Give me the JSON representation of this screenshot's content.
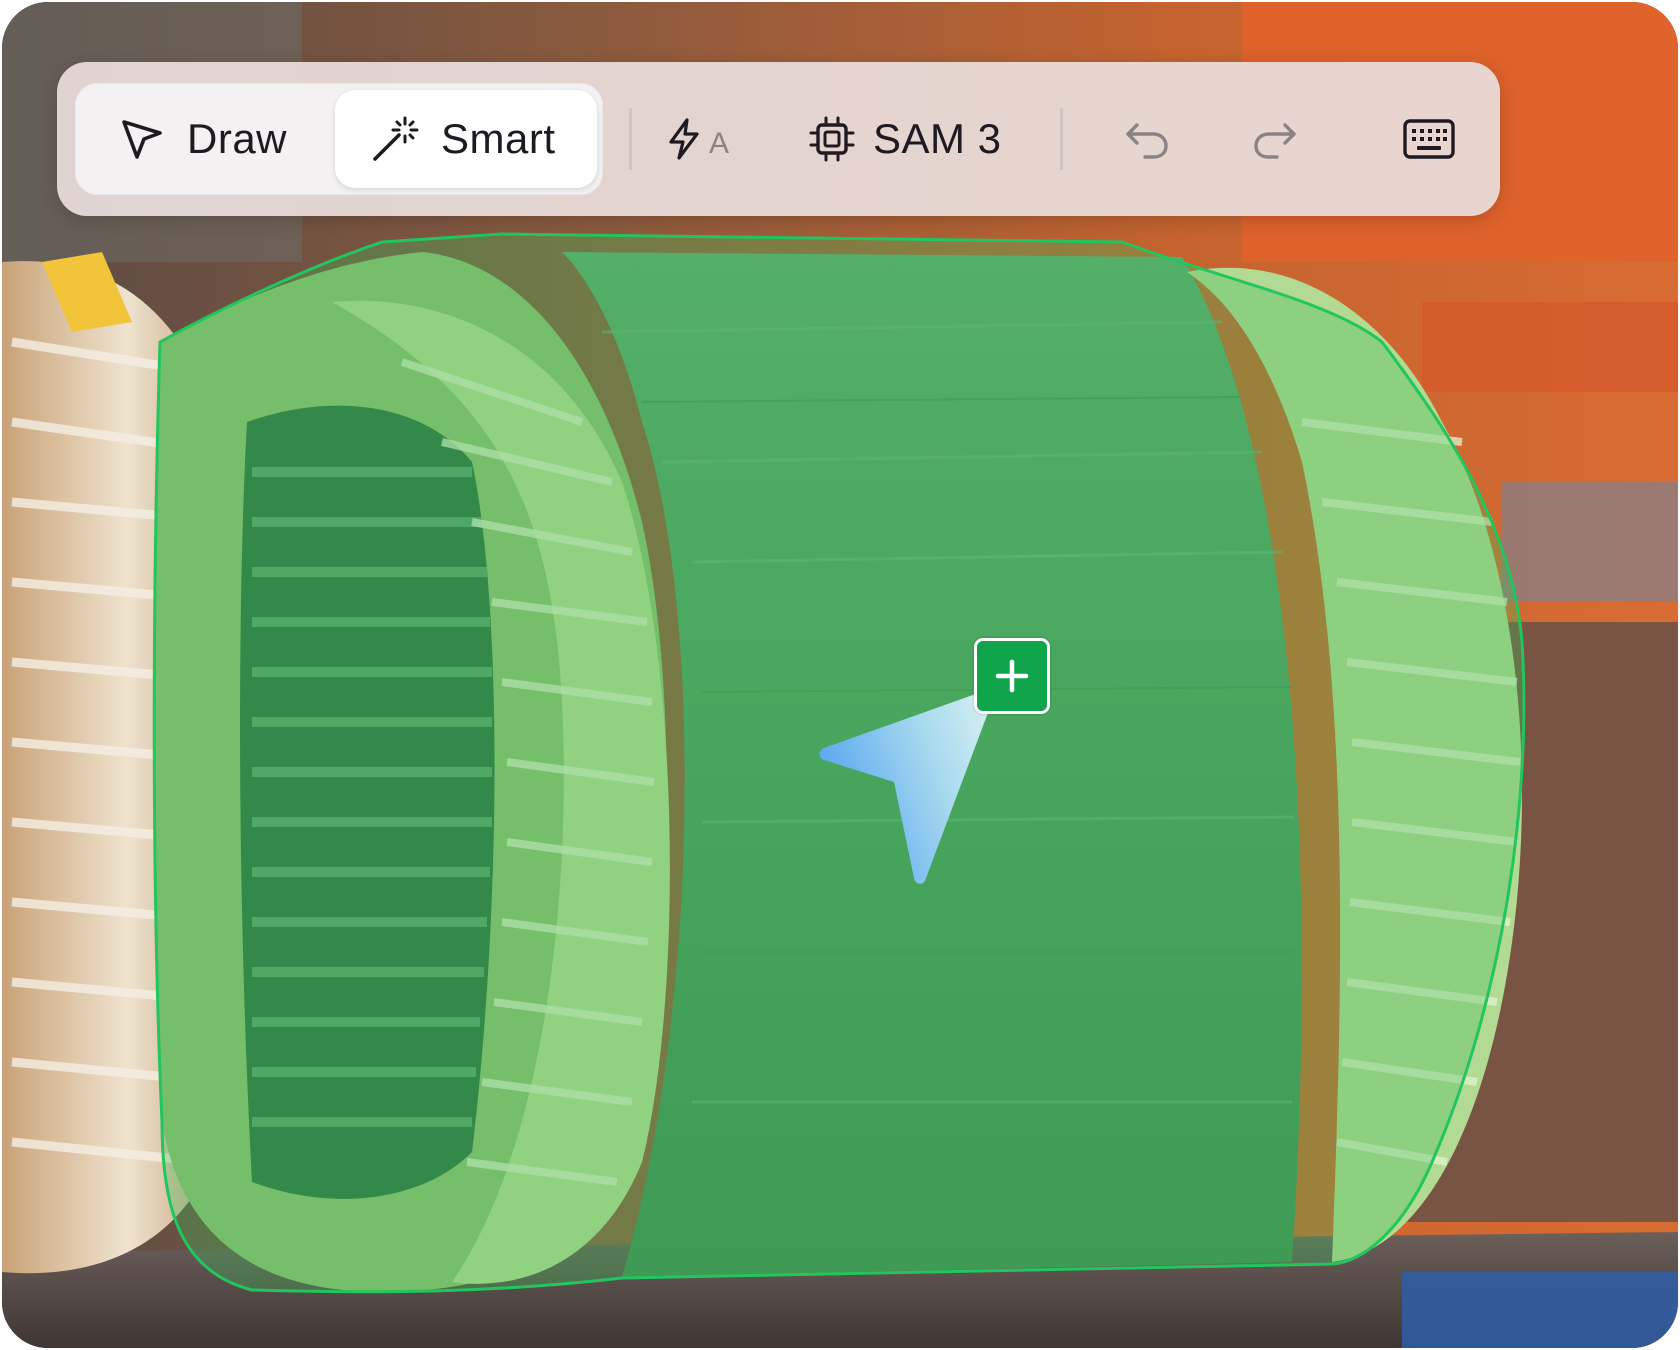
{
  "toolbar": {
    "draw_label": "Draw",
    "smart_label": "Smart",
    "auto_label": "A",
    "model_label": "SAM 3",
    "active_mode": "Smart"
  },
  "icons": {
    "draw": "pointer-arrow-icon",
    "smart": "magic-wand-icon",
    "auto": "lightning-auto-icon",
    "model": "chip-icon",
    "undo": "undo-icon",
    "redo": "redo-icon",
    "keyboard": "keyboard-icon",
    "add_point": "plus-icon",
    "cursor": "cursor-arrow-icon"
  },
  "colors": {
    "mask_fill": "#3fbf5a",
    "mask_outline": "#22c55e",
    "badge": "#13a84b",
    "cursor_light": "#d6f3f2",
    "cursor_dark": "#5aa8f0"
  }
}
